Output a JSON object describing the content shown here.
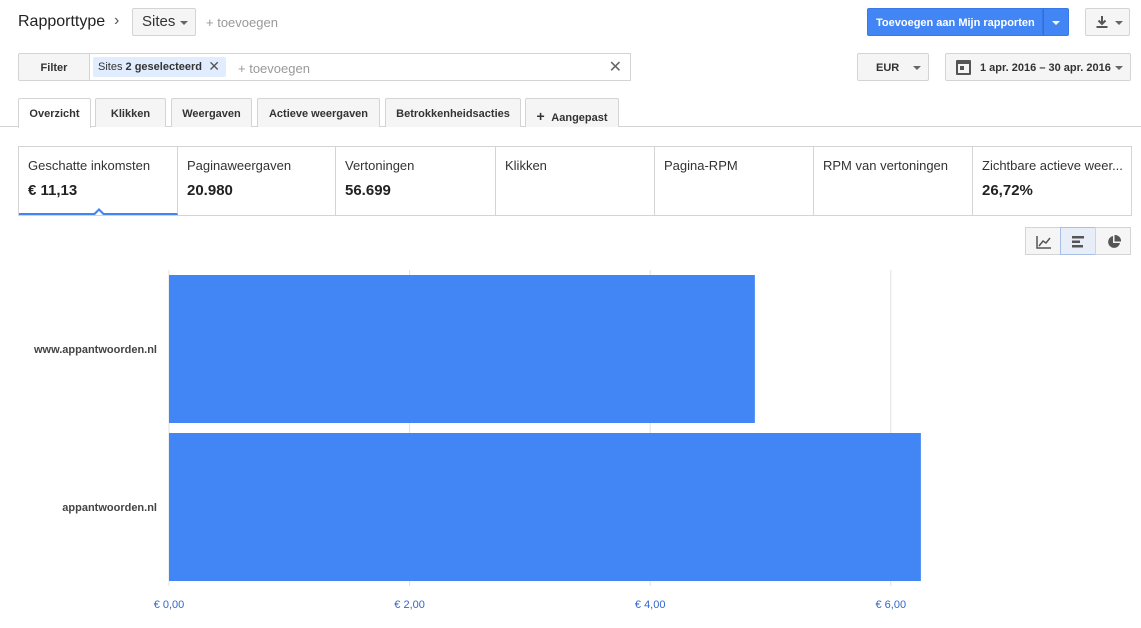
{
  "header": {
    "report_type_label": "Rapporttype",
    "dimension_value": "Sites",
    "add_dimension": "+ toevoegen",
    "add_to_reports": "Toevoegen aan Mijn rapporten"
  },
  "filter_bar": {
    "filter_label": "Filter",
    "chip_prefix": "Sites",
    "chip_value": "2 geselecteerd",
    "add_placeholder": "+ toevoegen",
    "currency": "EUR",
    "date_range": "1 apr. 2016 – 30 apr. 2016"
  },
  "tabs": [
    {
      "label": "Overzicht",
      "active": true
    },
    {
      "label": "Klikken",
      "active": false
    },
    {
      "label": "Weergaven",
      "active": false
    },
    {
      "label": "Actieve weergaven",
      "active": false
    },
    {
      "label": "Betrokkenheidsacties",
      "active": false
    },
    {
      "label": "Aangepast",
      "active": false
    }
  ],
  "metrics": [
    {
      "label": "Geschatte inkomsten",
      "value": "€ 11,13",
      "active": true
    },
    {
      "label": "Paginaweergaven",
      "value": "20.980",
      "active": false
    },
    {
      "label": "Vertoningen",
      "value": "56.699",
      "active": false
    },
    {
      "label": "Klikken",
      "value": "",
      "active": false
    },
    {
      "label": "Pagina-RPM",
      "value": "",
      "active": false
    },
    {
      "label": "RPM van vertoningen",
      "value": "",
      "active": false
    },
    {
      "label": "Zichtbare actieve weer...",
      "value": "26,72%",
      "active": false
    }
  ],
  "chart_types": [
    {
      "icon": "line-chart-icon",
      "active": false
    },
    {
      "icon": "bar-chart-icon",
      "active": true
    },
    {
      "icon": "pie-chart-icon",
      "active": false
    }
  ],
  "colors": {
    "accent": "#4285f4",
    "bar": "#4285f4",
    "axis_label": "#3366cc"
  },
  "chart_data": {
    "type": "bar",
    "orientation": "horizontal",
    "categories": [
      "www.appantwoorden.nl",
      "appantwoorden.nl"
    ],
    "values": [
      4.87,
      6.25
    ],
    "xlim": [
      0,
      8
    ],
    "xticks": [
      0,
      2,
      4,
      6
    ],
    "xtick_labels": [
      "€ 0,00",
      "€ 2,00",
      "€ 4,00",
      "€ 6,00"
    ],
    "grid": true
  }
}
